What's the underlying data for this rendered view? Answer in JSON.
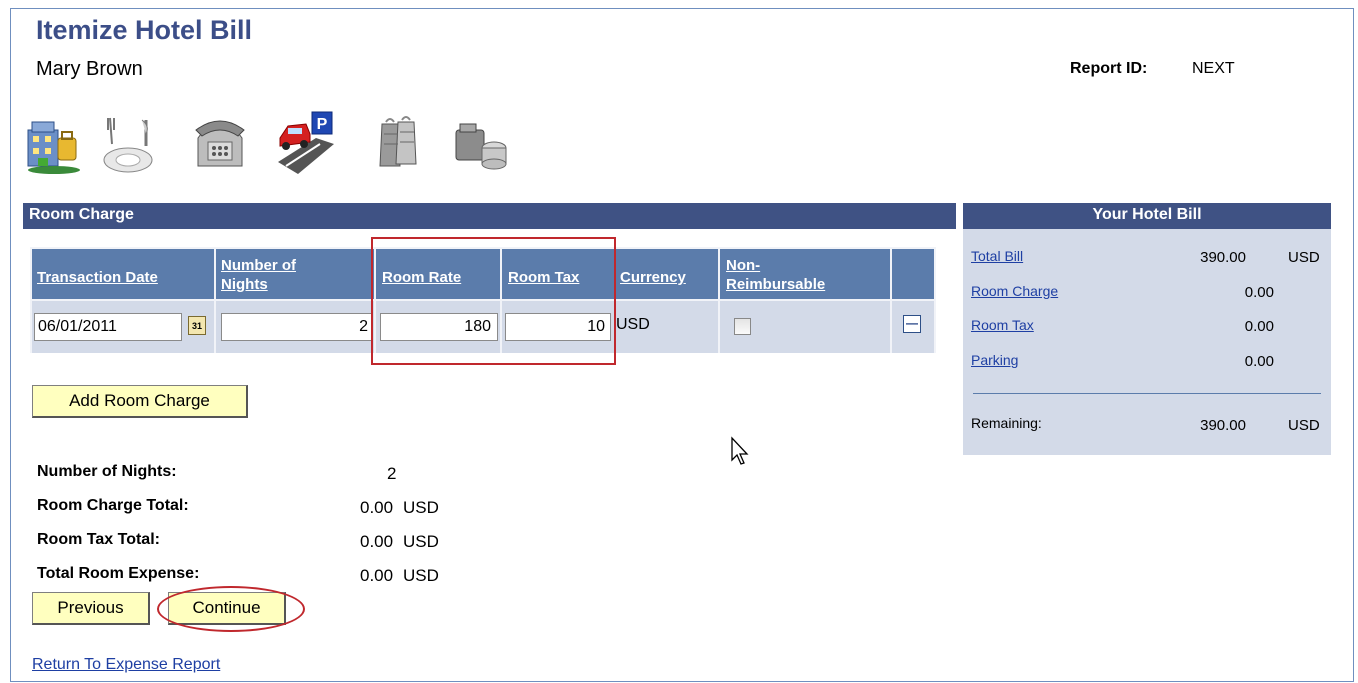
{
  "page": {
    "title": "Itemize Hotel Bill",
    "employee": "Mary Brown",
    "report_id_label": "Report ID:",
    "report_id_value": "NEXT"
  },
  "expense_icons": [
    {
      "name": "hotel-icon"
    },
    {
      "name": "dining-icon"
    },
    {
      "name": "telephone-icon"
    },
    {
      "name": "parking-icon"
    },
    {
      "name": "laundry-icon"
    },
    {
      "name": "miscellaneous-icon"
    }
  ],
  "room_charge": {
    "section_title": "Room Charge",
    "columns": {
      "transaction_date": "Transaction Date",
      "nights_line1": "Number of",
      "nights_line2": "Nights",
      "room_rate": "Room Rate",
      "room_tax": "Room Tax",
      "currency": "Currency",
      "nonreimb_line1": "Non-",
      "nonreimb_line2": "Reimbursable"
    },
    "row": {
      "transaction_date": "06/01/2011",
      "calendar_glyph": "31",
      "nights": "2",
      "room_rate": "180",
      "room_tax": "10",
      "currency": "USD",
      "non_reimbursable": false,
      "delete_glyph": "—"
    },
    "add_button": "Add Room Charge"
  },
  "summary": {
    "nights_label": "Number of Nights:",
    "nights_value": "2",
    "charge_label": "Room Charge Total:",
    "charge_value": "0.00",
    "tax_label": "Room Tax Total:",
    "tax_value": "0.00",
    "total_label": "Total Room Expense:",
    "total_value": "0.00",
    "currency": "USD"
  },
  "nav": {
    "previous": "Previous",
    "continue": "Continue",
    "return_link": "Return To Expense Report"
  },
  "hotel_bill": {
    "title": "Your Hotel Bill",
    "total_bill_label": "Total Bill",
    "total_bill_value": "390.00",
    "room_charge_label": "Room Charge",
    "room_charge_value": "0.00",
    "room_tax_label": "Room Tax",
    "room_tax_value": "0.00",
    "parking_label": "Parking",
    "parking_value": "0.00",
    "remaining_label": "Remaining:",
    "remaining_value": "390.00",
    "currency": "USD"
  },
  "colors": {
    "title": "#3c4e88",
    "section_bar": "#3f5284",
    "column_header": "#5b7cab",
    "row_background": "#d3dae8",
    "button": "#ffffbf",
    "highlight": "#c0282d"
  }
}
